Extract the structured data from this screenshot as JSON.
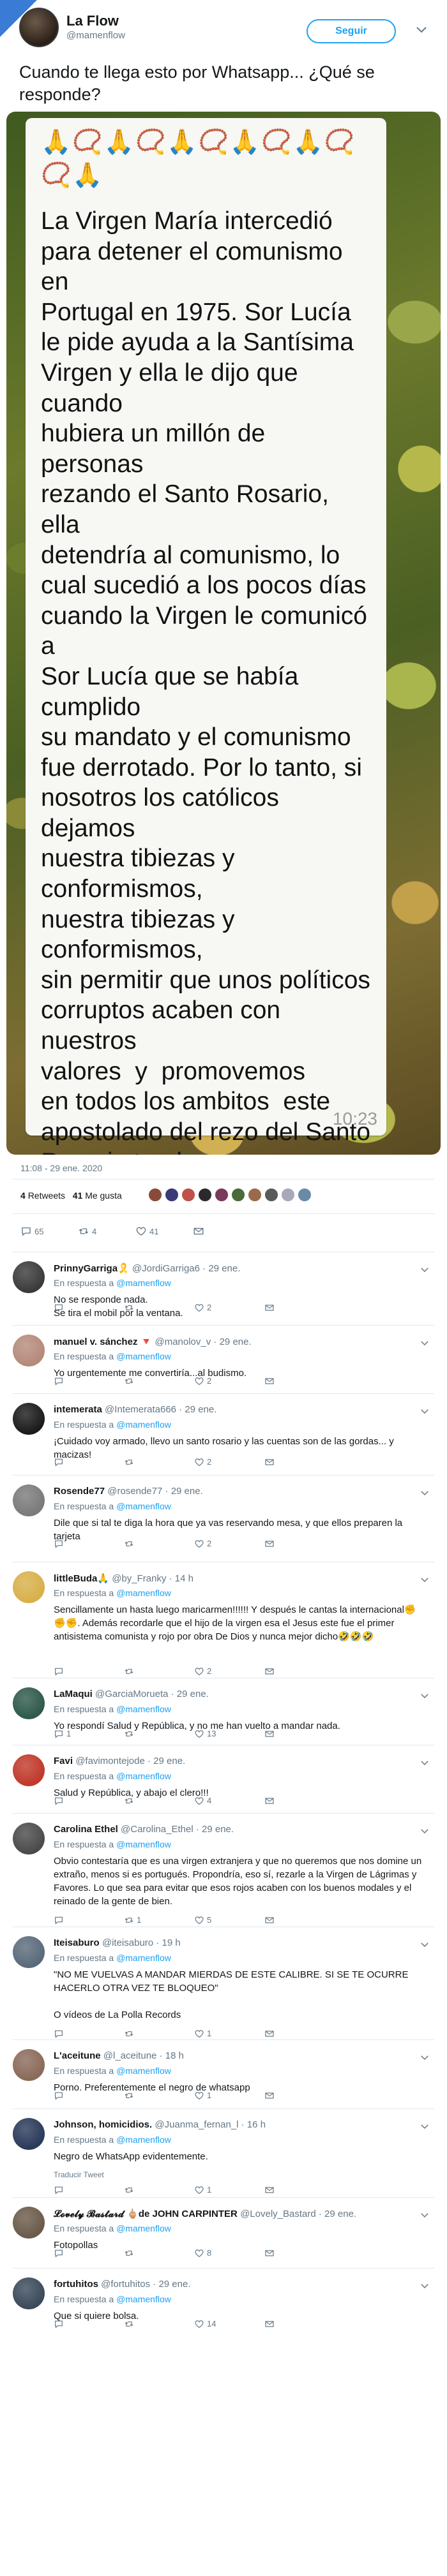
{
  "header": {
    "badge": "NOTICIAS LAS HORA",
    "author_name": "La Flow",
    "author_handle": "@mamenflow",
    "follow_label": "Seguir"
  },
  "tweet": {
    "text": "Cuando te llega esto por Whatsapp... ¿Qué se responde?",
    "date": "11:08 - 29 ene. 2020",
    "retweets": "4",
    "retweets_label": "Retweets",
    "likes": "41",
    "likes_label": "Me gusta",
    "reply_count": "65",
    "retweet_count": "4",
    "like_count": "41"
  },
  "whatsapp": {
    "emoji_top_1": "🙏📿🙏📿🙏📿🙏📿🙏📿",
    "emoji_top_2": "📿🙏",
    "body": "La Virgen María intercedió\npara detener el comunismo en\nPortugal en 1975. Sor Lucía\nle pide ayuda a la Santísima\nVirgen y ella le dijo que cuando\nhubiera un millón de personas\nrezando el Santo Rosario, ella\ndetendría al comunismo, lo\ncual sucedió a los pocos días\ncuando la Virgen le comunicó a\nSor Lucía que se había cumplido\nsu mandato y el comunismo\nfue derrotado. Por lo tanto, si\nnosotros los católicos dejamos\nnuestra tibiezas y conformismos,\nnuestra tibiezas y conformismos,\nsin permitir que unos políticos\ncorruptos acaben con nuestros\nvalores  y  promovemos\nen todos los ambitos  este\napostolado del rezo del Santo\nRosario tendremos un ejército\nvictorioso cuya capitana es la\nSantísima Virgen del Rosario\nde Fátima y así desterrar de\nuna vez por todas a esta ola de\ncorruptos Espero su apoyo y\ndivulgación por la salvación de\nnuestra patria y evitar que nos\nsuceda lo que actualmente sufre\nVenezuela. Con el Santo Rosario\nsalvaremos a España . Por favor\nayuden a difundir.\n Lo recibí y lo comparto .....",
    "emoji_bottom_1": "📿🙏📿🕊️🙏📿🕊️🙏📿",
    "emoji_bottom_2": "🕊️🙏📿",
    "time": "10:23"
  },
  "replies": [
    {
      "name": "PrinnyGarriga🎗️",
      "handle": "@JordiGarriga6",
      "date": "29 ene.",
      "in_reply": "En respuesta a",
      "mention": "@mamenflow",
      "text": "No se responde nada.\nSe tira el mobil por la ventana.",
      "replies": "",
      "retweets": "",
      "likes": "2",
      "avatar": "#3a3a3a"
    },
    {
      "name": "manuel v. sánchez 🔻",
      "handle": "@manolov_v",
      "date": "29 ene.",
      "in_reply": "En respuesta a",
      "mention": "@mamenflow",
      "text": "Yo urgentemente me convertiría...al budismo.",
      "replies": "",
      "retweets": "",
      "likes": "2",
      "avatar": "#b58a7a"
    },
    {
      "name": "intemerata",
      "handle": "@Intemerata666",
      "date": "29 ene.",
      "in_reply": "En respuesta a",
      "mention": "@mamenflow",
      "text": "¡Cuidado voy armado, llevo un santo rosario y las cuentas son de las gordas... y macizas!",
      "replies": "",
      "retweets": "",
      "likes": "2",
      "avatar": "#1a1a1a"
    },
    {
      "name": "Rosende77",
      "handle": "@rosende77",
      "date": "29 ene.",
      "in_reply": "En respuesta a",
      "mention": "@mamenflow",
      "text": "Dile que si tal te diga la hora que ya vas reservando mesa, y que ellos preparen la tarjeta",
      "replies": "",
      "retweets": "",
      "likes": "2",
      "avatar": "#7a7a7a"
    },
    {
      "name": "littleBuda🙏",
      "handle": "@by_Franky",
      "date": "14 h",
      "in_reply": "En respuesta a",
      "mention": "@mamenflow",
      "text": "Sencillamente un hasta luego maricarmen!!!!!! Y después le cantas la internacional✊✊✊. Además recordarle que el hijo de la virgen esa el Jesus este fue el primer antisistema comunista y rojo por obra De Dios y nunca mejor dicho🤣🤣🤣",
      "replies": "",
      "retweets": "",
      "likes": "2",
      "avatar": "#d8b04a"
    },
    {
      "name": "LaMaqui",
      "handle": "@GarciaMorueta",
      "date": "29 ene.",
      "in_reply": "En respuesta a",
      "mention": "@mamenflow",
      "text": "Yo respondí Salud y República, y no me han vuelto a mandar nada.",
      "replies": "1",
      "retweets": "",
      "likes": "13",
      "avatar": "#2e5a4a"
    },
    {
      "name": "Favi",
      "handle": "@favimontejode",
      "date": "29 ene.",
      "in_reply": "En respuesta a",
      "mention": "@mamenflow",
      "text": "Salud y República, y abajo el clero!!!",
      "replies": "",
      "retweets": "",
      "likes": "4",
      "avatar": "#c0392b"
    },
    {
      "name": "Carolina Ethel",
      "handle": "@Carolina_Ethel",
      "date": "29 ene.",
      "in_reply": "En respuesta a",
      "mention": "@mamenflow",
      "text": "Obvio contestaría que es una virgen extranjera y que no queremos que nos domine un extraño, menos si es portugués. Propondría, eso sí, rezarle a la Virgen de Lágrimas y Favores. Lo que sea para evitar que esos rojos acaben con los buenos modales y el reinado de la gente de bien.",
      "replies": "",
      "retweets": "1",
      "likes": "5",
      "avatar": "#4a4a4a"
    },
    {
      "name": "Iteisaburo",
      "handle": "@iteisaburo",
      "date": "19 h",
      "in_reply": "En respuesta a",
      "mention": "@mamenflow",
      "text": "\"NO ME VUELVAS A MANDAR MIERDAS DE ESTE CALIBRE. SI SE TE OCURRE HACERLO OTRA VEZ TE BLOQUEO\"\n\nO vídeos de La Polla Records",
      "replies": "",
      "retweets": "",
      "likes": "1",
      "avatar": "#5a6a7a"
    },
    {
      "name": "L'aceitune",
      "handle": "@l_aceitune",
      "date": "18 h",
      "in_reply": "En respuesta a",
      "mention": "@mamenflow",
      "text": "Porno. Preferentemente el negro de whatsapp",
      "replies": "",
      "retweets": "",
      "likes": "1",
      "avatar": "#8a6a5a"
    },
    {
      "name": "Johnson, homicidios.",
      "handle": "@Juanma_fernan_l",
      "date": "16 h",
      "in_reply": "En respuesta a",
      "mention": "@mamenflow",
      "text": "Negro de WhatsApp evidentemente.",
      "translate": "Traducir Tweet",
      "replies": "",
      "retweets": "",
      "likes": "1",
      "avatar": "#2a3a5a"
    },
    {
      "name": "𝓛𝓸𝓿𝓮𝓵𝔂 𝓑𝓪𝓼𝓽𝓪𝓻𝓭 🖕🏼de JOHN CARPINTER",
      "handle": "@Lovely_Bastard",
      "date": "29 ene.",
      "in_reply": "En respuesta a",
      "mention": "@mamenflow",
      "text": "Fotopollas",
      "replies": "",
      "retweets": "",
      "likes": "8",
      "avatar": "#6a5a4a"
    },
    {
      "name": "fortuhitos",
      "handle": "@fortuhitos",
      "date": "29 ene.",
      "in_reply": "En respuesta a",
      "mention": "@mamenflow",
      "text": "Que si quiere bolsa.",
      "replies": "",
      "retweets": "",
      "likes": "14",
      "avatar": "#3a4a5a"
    }
  ]
}
